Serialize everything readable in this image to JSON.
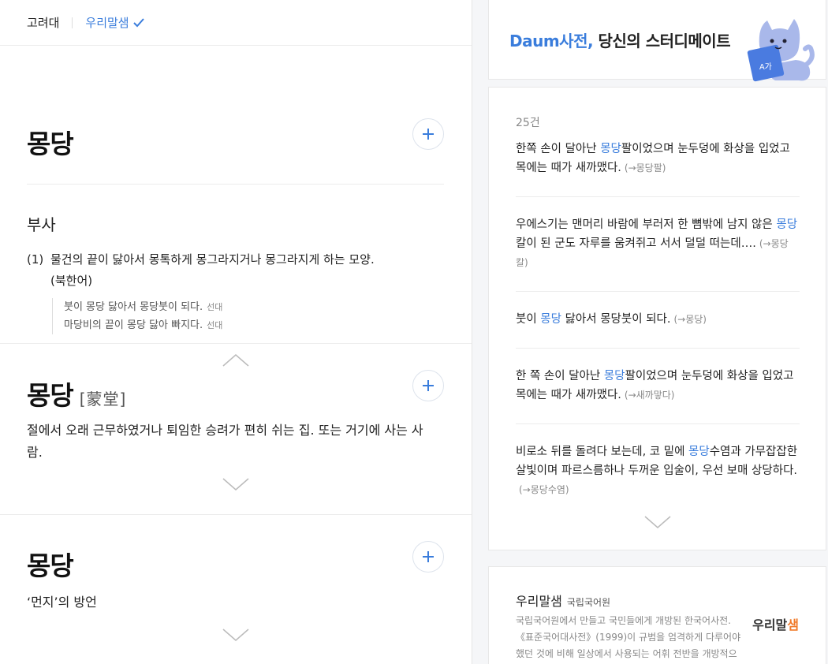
{
  "topbar": {
    "source_tab": "고려대",
    "active_tab": "우리말샘"
  },
  "entries": [
    {
      "word": "몽당",
      "pos": "부사",
      "definition_num": "(1)",
      "definition": "물건의 끝이 닳아서 몽톡하게 몽그라지거나 몽그라지게 하는 모양.",
      "definition_cont": "(북한어)",
      "examples": [
        {
          "text": "붓이 몽당 닳아서 몽당붓이 되다.",
          "tag": "선대"
        },
        {
          "text": "마당비의 끝이 몽당 닳아 빠지다.",
          "tag": "선대"
        }
      ]
    },
    {
      "word": "몽당",
      "hanja": "[蒙堂]",
      "definition": "절에서 오래 근무하였거나 퇴임한 승려가 편히 쉬는 집. 또는 거기에 사는 사람."
    },
    {
      "word": "몽당",
      "definition": "‘먼지’의 방언"
    }
  ],
  "banner": {
    "brand": "Daum사전,",
    "tagline": " 당신의 스터디메이트",
    "book_text": "A가"
  },
  "example_list": {
    "count": "25건",
    "items": [
      {
        "before": "한쪽 손이 달아난 ",
        "highlight": "몽당",
        "after": "팔이었으며 눈두덩에 화상을 입었고 목에는 때가 새까맸다.",
        "ref": "(→몽당팔)"
      },
      {
        "before": "우에스기는 맨머리 바람에 부러저 한 뼘밖에 남지 않은 ",
        "highlight": "몽당",
        "after": "칼이 된 군도 자루를 움켜쥐고 서서 덜덜 떠는데….",
        "ref": "(→몽당칼)"
      },
      {
        "before": "붓이 ",
        "highlight": "몽당",
        "after": " 닳아서 몽당붓이 되다.",
        "ref": "(→몽당)"
      },
      {
        "before": "한 쪽 손이 달아난 ",
        "highlight": "몽당",
        "after": "팔이었으며 눈두덩에 화상을 입었고 목에는 때가 새까맸다.",
        "ref": "(→새까맣다)"
      },
      {
        "before": "비로소 뒤를 돌려다 보는데, 코 밑에 ",
        "highlight": "몽당",
        "after": "수염과 가무잡잡한 살빛이며 파르스름하나 두꺼운 입술이, 우선 보매 상당하다.",
        "ref": "(→몽당수염)"
      }
    ]
  },
  "woorimalsaem": {
    "title": "우리말샘",
    "subtitle": "국립국어원",
    "description": "국립국어원에서 만들고 국민들에게 개방된 한국어사전.《표준국어대사전》(1999)이 규범을 엄격하게 다루어야 했던 것에 비해 일상에서 사용되는 어휘 전반을 개방적으로 다루고 있으므로 신어, 속어를 비롯해 다양한 어휘를 담고 있는 사전",
    "logo_main": "우리말",
    "logo_accent": "샘"
  },
  "colors": {
    "accent": "#3a7ddc",
    "logo_accent": "#f07a2a"
  }
}
